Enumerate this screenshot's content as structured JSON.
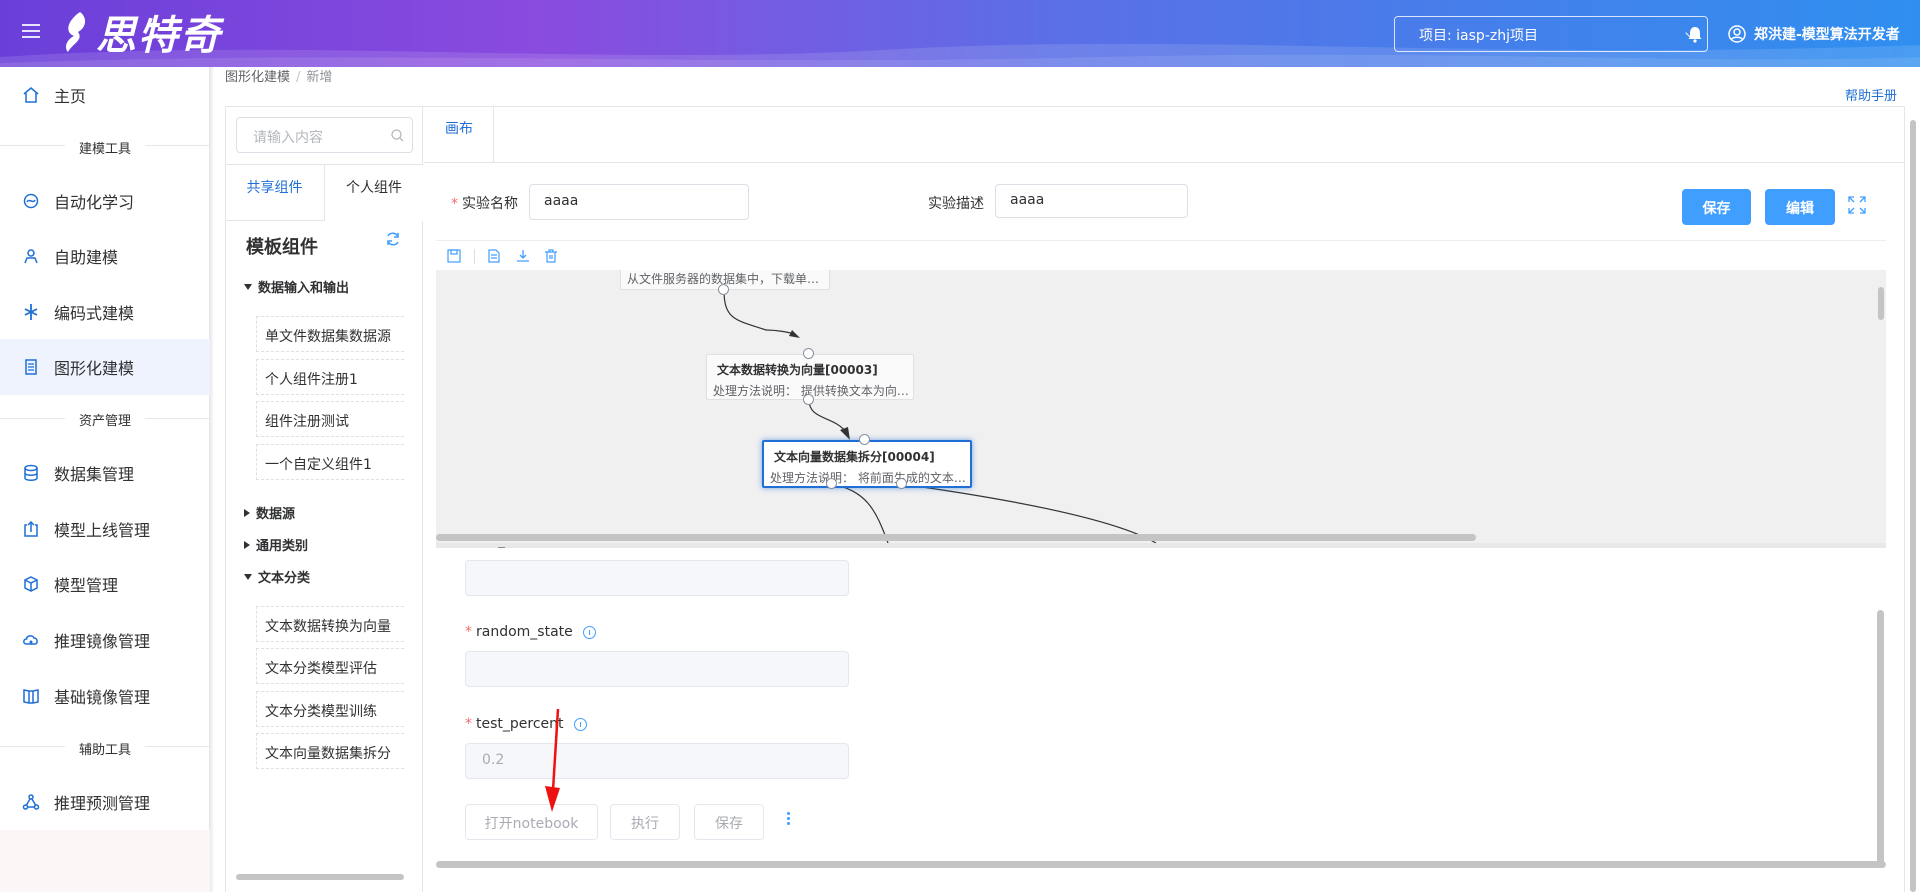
{
  "header": {
    "logo_text": "思特奇",
    "project_label": "项目: iasp-zhj项目",
    "user_label": "郑洪建-模型算法开发者"
  },
  "sidebar": {
    "home": "主页",
    "group_modeling": "建模工具",
    "items_modeling": [
      "自动化学习",
      "自助建模",
      "编码式建模",
      "图形化建模"
    ],
    "group_assets": "资产管理",
    "items_assets": [
      "数据集管理",
      "模型上线管理",
      "模型管理",
      "推理镜像管理",
      "基础镜像管理"
    ],
    "group_aux": "辅助工具",
    "items_aux": [
      "推理预测管理"
    ],
    "active": "图形化建模"
  },
  "breadcrumb": {
    "root": "图形化建模",
    "sep": "/",
    "current": "新增"
  },
  "help_link": "帮助手册",
  "left_panel": {
    "search_placeholder": "请输入内容",
    "tabs": [
      "共享组件",
      "个人组件"
    ],
    "title": "模板组件",
    "groups": [
      {
        "name": "数据输入和输出",
        "expanded": true,
        "items": [
          "单文件数据集数据源",
          "个人组件注册1",
          "组件注册测试",
          "一个自定义组件1"
        ]
      },
      {
        "name": "数据源",
        "expanded": false,
        "items": []
      },
      {
        "name": "通用类别",
        "expanded": false,
        "items": []
      },
      {
        "name": "文本分类",
        "expanded": true,
        "items": [
          "文本数据转换为向量",
          "文本分类模型评估",
          "文本分类模型训练",
          "文本向量数据集拆分"
        ]
      }
    ]
  },
  "canvas_tab": "画布",
  "experiment": {
    "name_label": "实验名称",
    "name_value": "aaaa",
    "desc_label": "实验描述",
    "desc_value": "aaaa",
    "save_button": "保存",
    "edit_button": "编辑"
  },
  "graph": {
    "nodes": [
      {
        "title": "",
        "desc": "从文件服务器的数据集中，下载单…"
      },
      {
        "title": "文本数据转换为向量[00003]",
        "desc": "处理方法说明：  提供转换文本为向…"
      },
      {
        "title": "文本向量数据集拆分[00004]",
        "desc": "处理方法说明：  将前面生成的文本…",
        "selected": true
      }
    ]
  },
  "params": {
    "partial_label": "_",
    "fields": [
      {
        "label": "random_state",
        "value": ""
      },
      {
        "label": "test_percent",
        "value": "0.2"
      }
    ],
    "buttons": [
      "打开notebook",
      "执行",
      "保存"
    ]
  },
  "colors": {
    "accent": "#409eff",
    "link": "#1f6fd6",
    "annotation_arrow": "#ee1111"
  }
}
